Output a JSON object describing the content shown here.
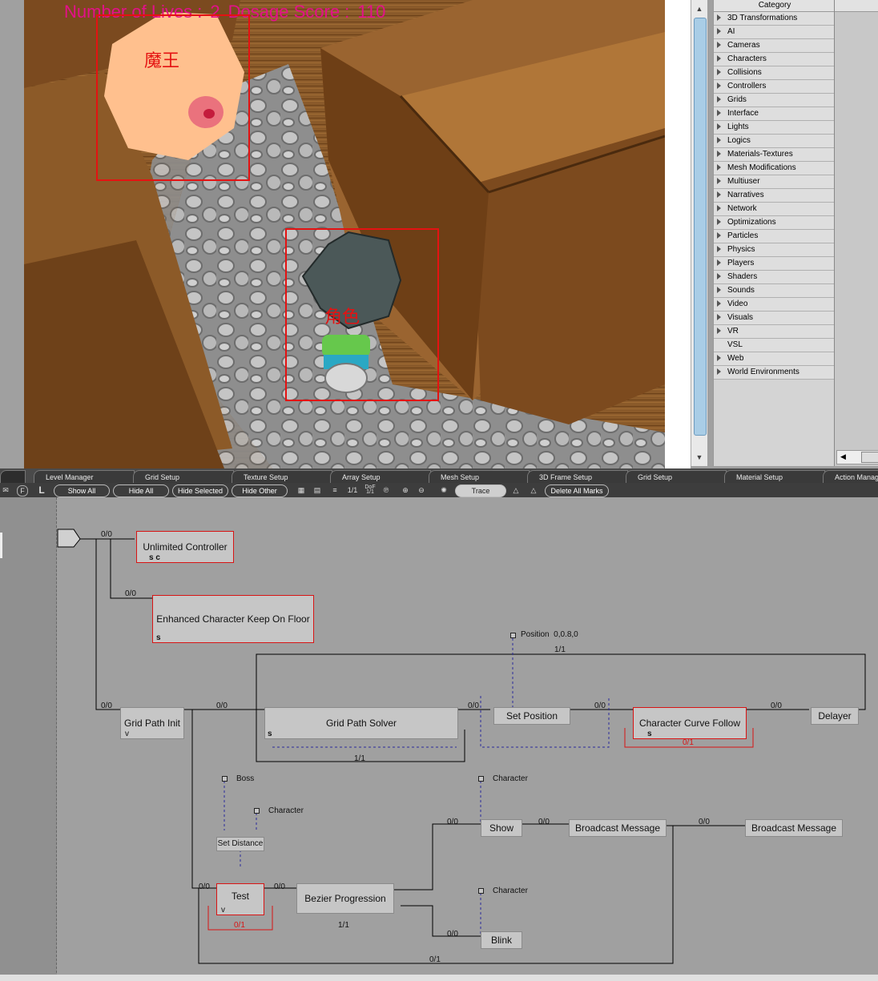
{
  "game": {
    "hud": {
      "lives_label": "Number of Lives :",
      "lives_value": "2",
      "score_label": "Dosage Score :",
      "score_value": "110"
    },
    "boss_label": "魔王",
    "character_label": "角色"
  },
  "category_panel": {
    "header": "Category",
    "items": [
      "3D Transformations",
      "AI",
      "Cameras",
      "Characters",
      "Collisions",
      "Controllers",
      "Grids",
      "Interface",
      "Lights",
      "Logics",
      "Materials-Textures",
      "Mesh Modifications",
      "Multiuser",
      "Narratives",
      "Network",
      "Optimizations",
      "Particles",
      "Physics",
      "Players",
      "Shaders",
      "Sounds",
      "Video",
      "Visuals",
      "VR",
      "VSL",
      "Web",
      "World Environments"
    ]
  },
  "tabs": [
    "Level Manager",
    "Grid Setup",
    "Texture Setup",
    "Array Setup",
    "Mesh Setup",
    "3D Frame Setup",
    "Grid Setup",
    "Material Setup",
    "Action Manag"
  ],
  "toolbar": {
    "show_all": "Show All",
    "hide_all": "Hide All",
    "hide_selected": "Hide Selected",
    "hide_other": "Hide Other",
    "trace": "Trace",
    "delete_all_marks": "Delete All Marks",
    "ratio": "1/1",
    "dof": "DoF 1/1"
  },
  "schematic": {
    "blocks": {
      "unlimited_controller": "Unlimited Controller",
      "enhanced_keep_on_floor": "Enhanced Character Keep On Floor",
      "grid_path_init": "Grid Path Init",
      "grid_path_solver": "Grid Path Solver",
      "set_position": "Set Position",
      "character_curve_follow": "Character Curve Follow",
      "delayer": "Delayer",
      "set_distance": "Set Distance",
      "test": "Test",
      "bezier_progression": "Bezier Progression",
      "show": "Show",
      "broadcast_message_1": "Broadcast Message",
      "broadcast_message_2": "Broadcast Message",
      "blink": "Blink"
    },
    "params": {
      "position": "Position",
      "position_value": "0,0.8,0",
      "boss": "Boss",
      "character_1": "Character",
      "character_2": "Character",
      "character_3": "Character"
    },
    "link_labels": {
      "l00": "0/0",
      "l01": "1/1",
      "l11": "0/1",
      "l_bot": "0/1"
    },
    "letters": {
      "s": "s",
      "c": "c",
      "v": "v"
    }
  }
}
